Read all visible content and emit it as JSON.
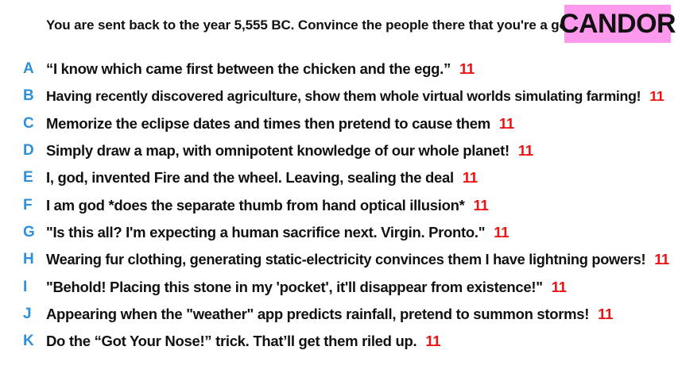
{
  "prompt": "You are sent back to the year 5,555 BC. Convince the people there that you're a god.",
  "logo": "CANDOR",
  "colors": {
    "letter": "#2f8fd8",
    "score": "#ee1111",
    "logo_bg": "#ff99ee"
  },
  "answers": [
    {
      "letter": "A",
      "text": "“I know which came first between the chicken and the egg.”",
      "score": "11"
    },
    {
      "letter": "B",
      "text": "Having recently discovered agriculture, show them whole virtual worlds simulating farming!",
      "score": "11"
    },
    {
      "letter": "C",
      "text": "Memorize the eclipse dates and times then pretend to cause them",
      "score": "11"
    },
    {
      "letter": "D",
      "text": "Simply draw a map, with omnipotent knowledge of our whole planet!",
      "score": "11"
    },
    {
      "letter": "E",
      "text": "I, god, invented Fire and the wheel. Leaving, sealing the deal",
      "score": "11"
    },
    {
      "letter": "F",
      "text": "I am god *does the separate thumb from hand optical illusion*",
      "score": "11"
    },
    {
      "letter": "G",
      "text": "\"Is this all? I'm expecting a human sacrifice next. Virgin. Pronto.\"",
      "score": "11"
    },
    {
      "letter": "H",
      "text": "Wearing fur clothing, generating static-electricity convinces them I have lightning powers!",
      "score": "11"
    },
    {
      "letter": "I",
      "text": "\"Behold! Placing this stone in my 'pocket', it'll disappear from existence!\"",
      "score": "11"
    },
    {
      "letter": "J",
      "text": "Appearing when the \"weather\" app predicts rainfall, pretend to summon storms!",
      "score": "11"
    },
    {
      "letter": "K",
      "text": "Do the “Got Your Nose!” trick. That’ll get them riled up.",
      "score": "11"
    }
  ]
}
